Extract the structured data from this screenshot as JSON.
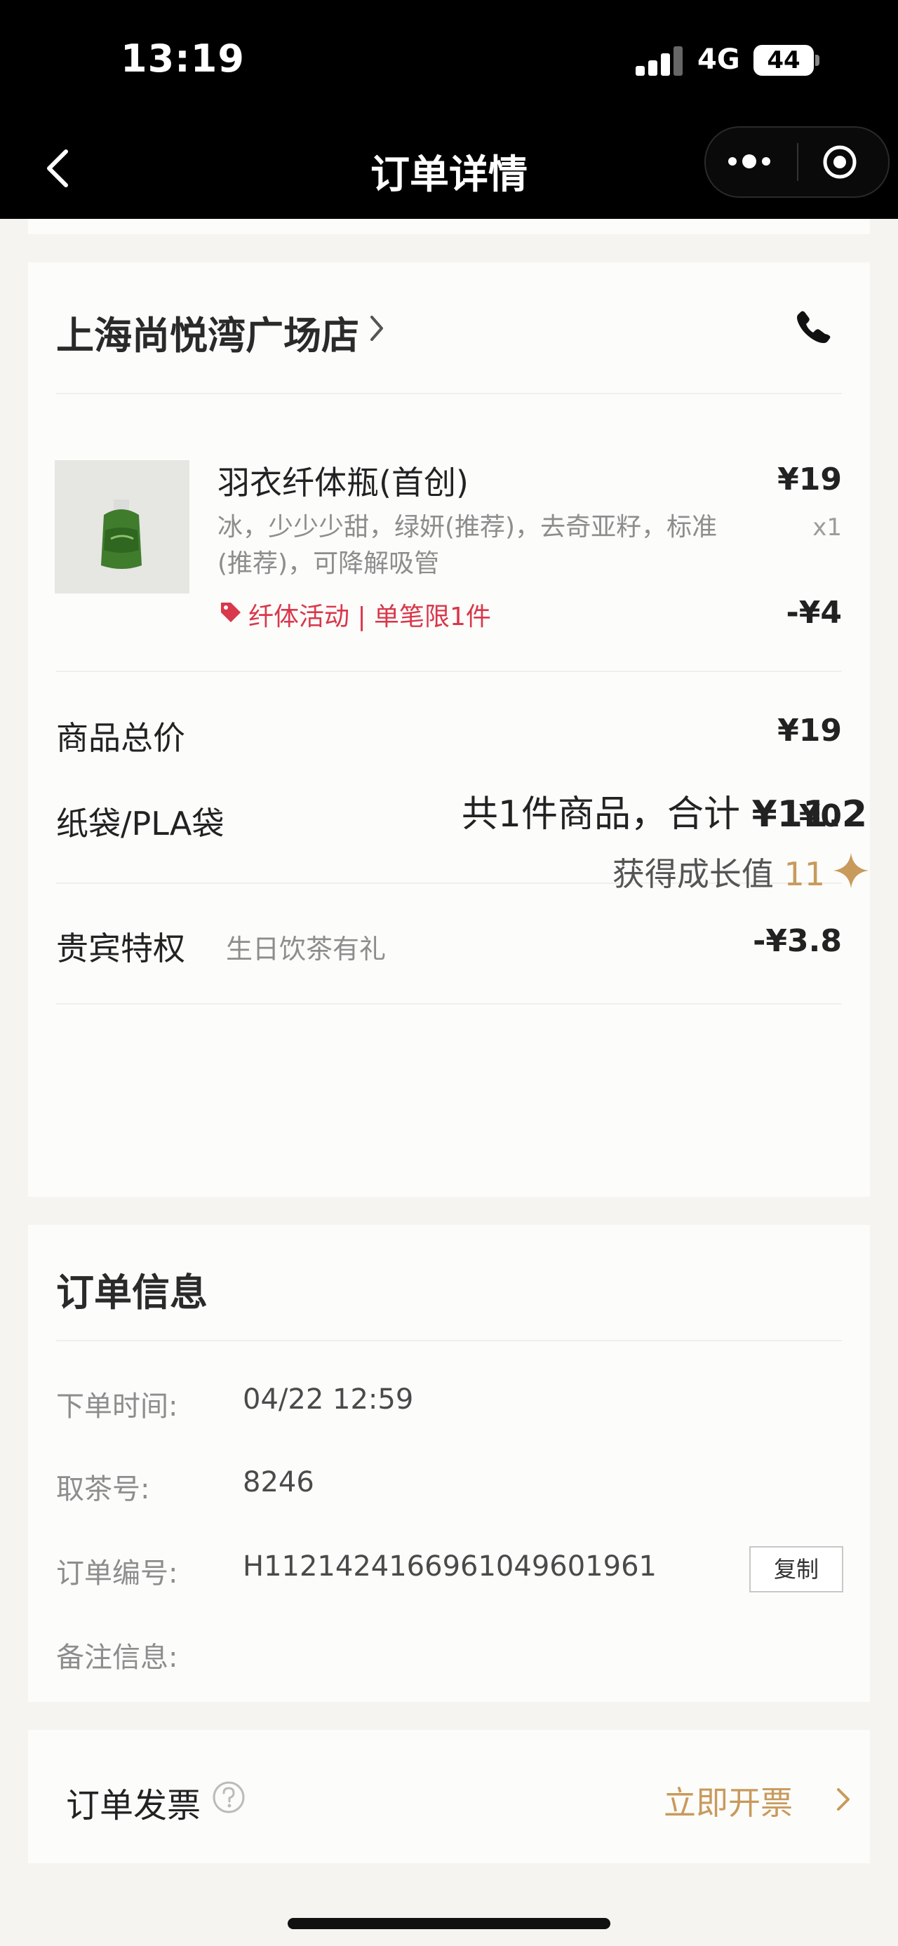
{
  "status_bar": {
    "time": "13:19",
    "network": "4G",
    "battery": "44"
  },
  "nav": {
    "title": "订单详情"
  },
  "store": {
    "name": "上海尚悦湾广场店"
  },
  "product": {
    "name": "羽衣纤体瓶(首创)",
    "options": "冰，少少少甜，绿妍(推荐)，去奇亚籽，标准(推荐)，可降解吸管",
    "promo": "纤体活动 | 单笔限1件",
    "price": "¥19",
    "quantity": "x1",
    "discount": "-¥4"
  },
  "summary": {
    "subtotal_label": "商品总价",
    "subtotal_value": "¥19",
    "bag_label": "纸袋/PLA袋",
    "bag_value": "¥0",
    "vip_label": "贵宾特权",
    "vip_desc": "生日饮茶有礼",
    "vip_value": "-¥3.8",
    "total_prefix": "共1件商品，合计",
    "total_value": "¥11.2",
    "growth_label": "获得成长值",
    "growth_value": "11"
  },
  "order_info": {
    "title": "订单信息",
    "order_time_label": "下单时间:",
    "order_time_value": "04/22 12:59",
    "pickup_label": "取茶号:",
    "pickup_value": "8246",
    "order_no_label": "订单编号:",
    "order_no_value": "H1121424166961049601961",
    "copy_label": "复制",
    "remark_label": "备注信息:"
  },
  "invoice": {
    "label": "订单发票",
    "action": "立即开票"
  },
  "colors": {
    "accent_gold": "#c89a5c",
    "promo_red": "#d9374b",
    "nav_bg": "#000000"
  },
  "icons": [
    "back-arrow-icon",
    "more-dots-icon",
    "target-icon",
    "chevron-right-icon",
    "phone-icon",
    "tag-icon",
    "sparkle-icon",
    "help-icon"
  ]
}
